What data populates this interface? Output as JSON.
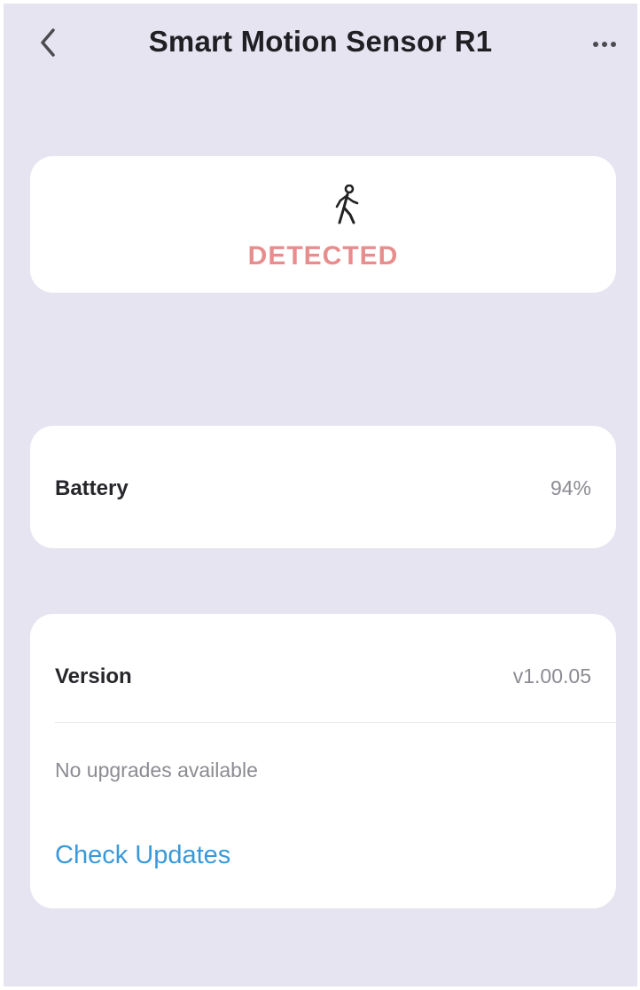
{
  "header": {
    "title": "Smart Motion Sensor R1",
    "back_icon": "chevron-left-icon",
    "more_icon": "more-horizontal-icon"
  },
  "status": {
    "icon": "walking-person-icon",
    "text": "DETECTED",
    "color": "#e88d8d"
  },
  "battery": {
    "label": "Battery",
    "value": "94%"
  },
  "version": {
    "label": "Version",
    "value": "v1.00.05",
    "upgrade_status": "No upgrades available",
    "check_updates_label": "Check Updates",
    "link_color": "#3a99d8"
  },
  "colors": {
    "background": "#e6e4f0",
    "card": "#ffffff",
    "title": "#1f1f24",
    "secondary_text": "#8b8b92"
  }
}
